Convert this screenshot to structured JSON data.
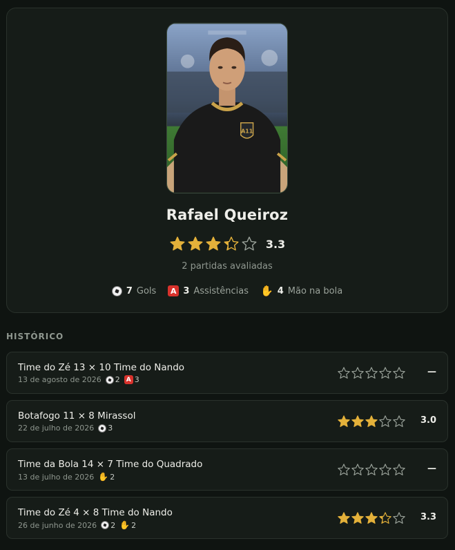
{
  "profile": {
    "name": "Rafael Queiroz",
    "rating": 3.3,
    "rating_label": "3.3",
    "rated_count": "2 partidas avaliadas",
    "jersey_badge": "A11",
    "stats": [
      {
        "icon": "soccer-ball-icon",
        "value": "7",
        "label": "Gols"
      },
      {
        "icon": "assist-icon",
        "value": "3",
        "label": "Assistências"
      },
      {
        "icon": "hand-icon",
        "value": "4",
        "label": "Mão na bola"
      }
    ]
  },
  "history": {
    "title": "HISTÓRICO",
    "matches": [
      {
        "title": "Time do Zé 13 × 10 Time do Nando",
        "date": "13 de agosto de 2026",
        "goals": "2",
        "assists": "3",
        "hands": null,
        "rating": 0,
        "rating_label": "—"
      },
      {
        "title": "Botafogo 11 × 8 Mirassol",
        "date": "22 de julho de 2026",
        "goals": "3",
        "assists": null,
        "hands": null,
        "rating": 3.0,
        "rating_label": "3.0"
      },
      {
        "title": "Time da Bola 14 × 7 Time do Quadrado",
        "date": "13 de julho de 2026",
        "goals": null,
        "assists": null,
        "hands": "2",
        "rating": 0,
        "rating_label": "—"
      },
      {
        "title": "Time do Zé 4 × 8 Time do Nando",
        "date": "26 de junho de 2026",
        "goals": "2",
        "assists": null,
        "hands": "2",
        "rating": 3.3,
        "rating_label": "3.3"
      }
    ]
  },
  "colors": {
    "star": "#e4b13a",
    "star_empty": "#9aa29a",
    "accent": "#c9a24a"
  }
}
